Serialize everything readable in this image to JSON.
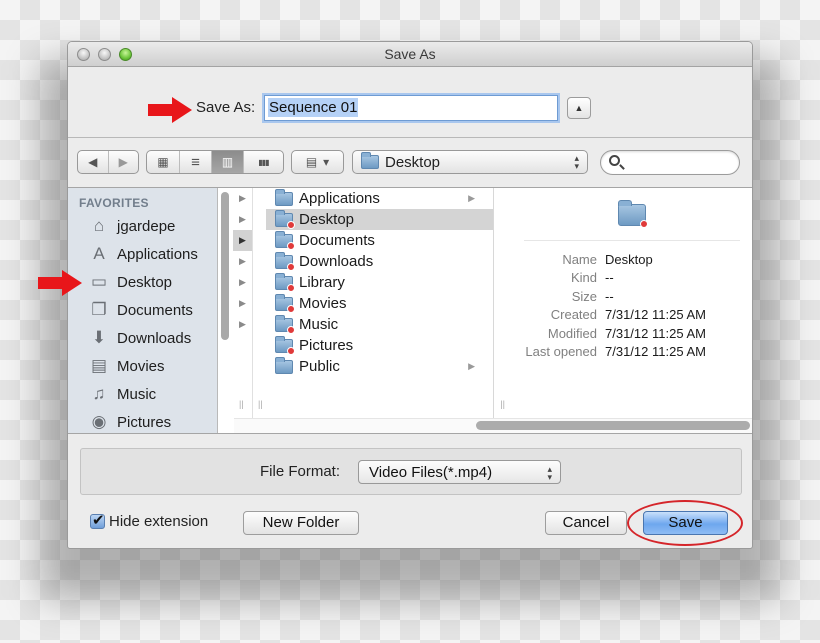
{
  "window": {
    "title": "Save As",
    "traffic_lights": [
      "close",
      "minimize",
      "zoom"
    ]
  },
  "save_as": {
    "label": "Save As:",
    "value": "Sequence 01",
    "expand_icon": "▲",
    "annotation": "red-arrow"
  },
  "toolbar": {
    "back_icon": "◀",
    "forward_icon": "▶",
    "views": [
      {
        "name": "icon-view",
        "glyph": "▦",
        "active": false
      },
      {
        "name": "list-view",
        "glyph": "≡",
        "active": false
      },
      {
        "name": "column-view",
        "glyph": "▥",
        "active": true
      },
      {
        "name": "coverflow-view",
        "glyph": "▮▮▮",
        "active": false
      }
    ],
    "arrange_icon": "▤",
    "arrange_chevron": "▾",
    "location": "Desktop",
    "search_placeholder": ""
  },
  "sidebar": {
    "heading": "FAVORITES",
    "items": [
      {
        "label": "jgardepe",
        "icon": "home-icon",
        "glyph": "⌂"
      },
      {
        "label": "Applications",
        "icon": "applications-icon",
        "glyph": "A"
      },
      {
        "label": "Desktop",
        "icon": "desktop-icon",
        "glyph": "▭",
        "annotated": true
      },
      {
        "label": "Documents",
        "icon": "documents-icon",
        "glyph": "❐"
      },
      {
        "label": "Downloads",
        "icon": "downloads-icon",
        "glyph": "⬇"
      },
      {
        "label": "Movies",
        "icon": "movies-icon",
        "glyph": "▤"
      },
      {
        "label": "Music",
        "icon": "music-icon",
        "glyph": "♫"
      },
      {
        "label": "Pictures",
        "icon": "pictures-icon",
        "glyph": "◉"
      }
    ]
  },
  "column0": {
    "arrows": [
      "▶",
      "▶",
      "▶",
      "▶",
      "▶",
      "▶",
      "▶"
    ],
    "selected_index": 2
  },
  "column1": {
    "items": [
      {
        "label": "Applications",
        "has_children": true,
        "restricted": false
      },
      {
        "label": "Desktop",
        "has_children": false,
        "restricted": true,
        "selected": true
      },
      {
        "label": "Documents",
        "has_children": false,
        "restricted": true
      },
      {
        "label": "Downloads",
        "has_children": false,
        "restricted": true
      },
      {
        "label": "Library",
        "has_children": false,
        "restricted": true
      },
      {
        "label": "Movies",
        "has_children": false,
        "restricted": true
      },
      {
        "label": "Music",
        "has_children": false,
        "restricted": true
      },
      {
        "label": "Pictures",
        "has_children": false,
        "restricted": true
      },
      {
        "label": "Public",
        "has_children": true,
        "restricted": false
      }
    ],
    "child_arrow": "▶"
  },
  "preview": {
    "rows": [
      {
        "key": "Name",
        "value": "Desktop"
      },
      {
        "key": "Kind",
        "value": "--"
      },
      {
        "key": "Size",
        "value": "--"
      },
      {
        "key": "Created",
        "value": "7/31/12 11:25 AM"
      },
      {
        "key": "Modified",
        "value": "7/31/12 11:25 AM"
      },
      {
        "key": "Last opened",
        "value": "7/31/12 11:25 AM"
      }
    ]
  },
  "format": {
    "label": "File Format:",
    "value": "Video Files(*.mp4)"
  },
  "footer": {
    "hide_extension_label": "Hide extension",
    "hide_extension_checked": true,
    "new_folder": "New Folder",
    "cancel": "Cancel",
    "save": "Save"
  },
  "colors": {
    "annotation_red": "#e8161a",
    "save_button_blue": "#6ea7ee",
    "selection_gray": "#d4d4d4"
  }
}
